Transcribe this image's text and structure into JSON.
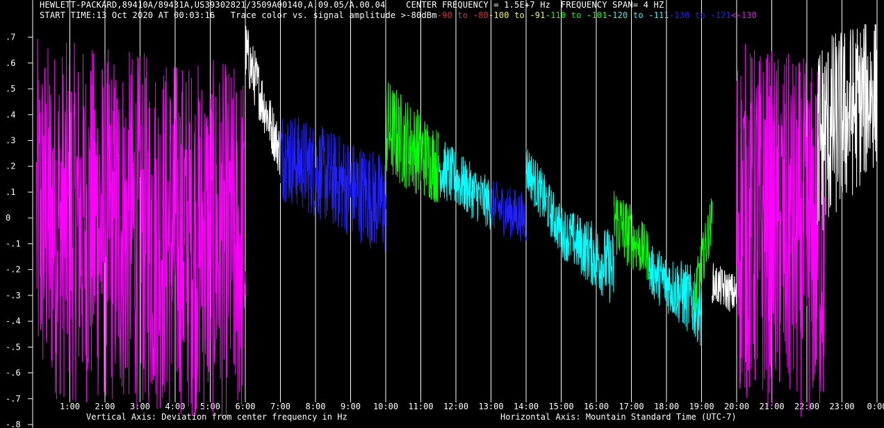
{
  "header": {
    "instrument": "HEWLETT-PACKARD,89410A/89431A,US39302821/3509A00140,A.09.05/A.00.04",
    "center_frequency": "CENTER FREQUENCY = 1.5E+7 Hz",
    "frequency_span": "FREQUENCY SPAN= 4 HZ",
    "start_time": "START TIME:13 Oct 2020 AT 00:03:16",
    "trace_legend_label": "Trace color vs. signal amplitude",
    "legend": [
      {
        "text": ">-80dBm",
        "color": "#ffffff"
      },
      {
        "text": "-90 to -80",
        "color": "#ff2020"
      },
      {
        "text": "-100 to -91",
        "color": "#ffff00"
      },
      {
        "text": "-110 to -101",
        "color": "#00ff00"
      },
      {
        "text": "-120 to -111",
        "color": "#00ffff"
      },
      {
        "text": "-130 to -121",
        "color": "#2020ff"
      },
      {
        "text": "<-130",
        "color": "#ff00ff"
      }
    ]
  },
  "footer": {
    "vertical_axis": "Vertical Axis: Deviation from center frequency in Hz",
    "horizontal_axis": "Horizontal Axis: Mountain Standard Time (UTC-7)"
  },
  "chart_data": {
    "type": "line",
    "xlabel": "Horizontal Axis: Mountain Standard Time (UTC-7)",
    "ylabel": "Vertical Axis: Deviation from center frequency in Hz",
    "xlim": [
      0,
      24
    ],
    "ylim": [
      -0.8,
      0.75
    ],
    "x_ticks": [
      "1:00",
      "2:00",
      "3:00",
      "4:00",
      "5:00",
      "6:00",
      "7:00",
      "8:00",
      "9:00",
      "10:00",
      "11:00",
      "12:00",
      "13:00",
      "14:00",
      "15:00",
      "16:00",
      "17:00",
      "18:00",
      "19:00",
      "20:00",
      "21:00",
      "22:00",
      "23:00",
      "0:00"
    ],
    "y_ticks": [
      {
        "v": 0.7,
        "label": ".7"
      },
      {
        "v": 0.6,
        "label": ".6"
      },
      {
        "v": 0.5,
        "label": ".5"
      },
      {
        "v": 0.4,
        "label": ".4"
      },
      {
        "v": 0.3,
        "label": ".3"
      },
      {
        "v": 0.2,
        "label": ".2"
      },
      {
        "v": 0.1,
        "label": ".1"
      },
      {
        "v": 0,
        "label": "0"
      },
      {
        "v": -0.1,
        "label": "-.1"
      },
      {
        "v": -0.2,
        "label": "-.2"
      },
      {
        "v": -0.3,
        "label": "-.3"
      },
      {
        "v": -0.4,
        "label": "-.4"
      },
      {
        "v": -0.5,
        "label": "-.5"
      },
      {
        "v": -0.6,
        "label": "-.6"
      },
      {
        "v": -0.7,
        "label": "-.7"
      },
      {
        "v": -0.8,
        "label": "-.8"
      }
    ],
    "grid": "vertical",
    "series": [
      {
        "color": "#ff00ff",
        "t": [
          0.05,
          6.0
        ],
        "center": [
          0.0,
          -0.1
        ],
        "spread": [
          0.7,
          0.7
        ]
      },
      {
        "color": "#ffffff",
        "t": [
          6.0,
          7.0
        ],
        "center": [
          0.65,
          0.25
        ],
        "spread": [
          0.12,
          0.1
        ]
      },
      {
        "color": "#2020ff",
        "t": [
          7.0,
          10.0
        ],
        "center": [
          0.25,
          0.05
        ],
        "spread": [
          0.18,
          0.2
        ]
      },
      {
        "color": "#00ff00",
        "t": [
          10.0,
          11.5
        ],
        "center": [
          0.35,
          0.2
        ],
        "spread": [
          0.2,
          0.15
        ]
      },
      {
        "color": "#00ffff",
        "t": [
          11.5,
          13.0
        ],
        "center": [
          0.2,
          0.05
        ],
        "spread": [
          0.12,
          0.1
        ]
      },
      {
        "color": "#2020ff",
        "t": [
          13.0,
          14.0
        ],
        "center": [
          0.05,
          0.0
        ],
        "spread": [
          0.1,
          0.1
        ]
      },
      {
        "color": "#00ffff",
        "t": [
          14.0,
          15.0
        ],
        "center": [
          0.2,
          -0.05
        ],
        "spread": [
          0.1,
          0.1
        ]
      },
      {
        "color": "#00ffff",
        "t": [
          15.0,
          16.5
        ],
        "center": [
          -0.05,
          -0.2
        ],
        "spread": [
          0.1,
          0.15
        ]
      },
      {
        "color": "#00ff00",
        "t": [
          16.5,
          17.5
        ],
        "center": [
          0.0,
          -0.15
        ],
        "spread": [
          0.15,
          0.1
        ]
      },
      {
        "color": "#00ffff",
        "t": [
          17.5,
          19.0
        ],
        "center": [
          -0.2,
          -0.35
        ],
        "spread": [
          0.1,
          0.15
        ]
      },
      {
        "color": "#00ff00",
        "t": [
          18.8,
          19.3
        ],
        "center": [
          -0.3,
          0.0
        ],
        "spread": [
          0.1,
          0.1
        ]
      },
      {
        "color": "#ffffff",
        "t": [
          19.3,
          20.0
        ],
        "center": [
          -0.25,
          -0.3
        ],
        "spread": [
          0.08,
          0.08
        ]
      },
      {
        "color": "#ff00ff",
        "t": [
          20.0,
          22.5
        ],
        "center": [
          0.0,
          -0.1
        ],
        "spread": [
          0.7,
          0.7
        ]
      },
      {
        "color": "#ffffff",
        "t": [
          22.3,
          24.0
        ],
        "center": [
          0.3,
          0.5
        ],
        "spread": [
          0.4,
          0.3
        ]
      }
    ]
  }
}
